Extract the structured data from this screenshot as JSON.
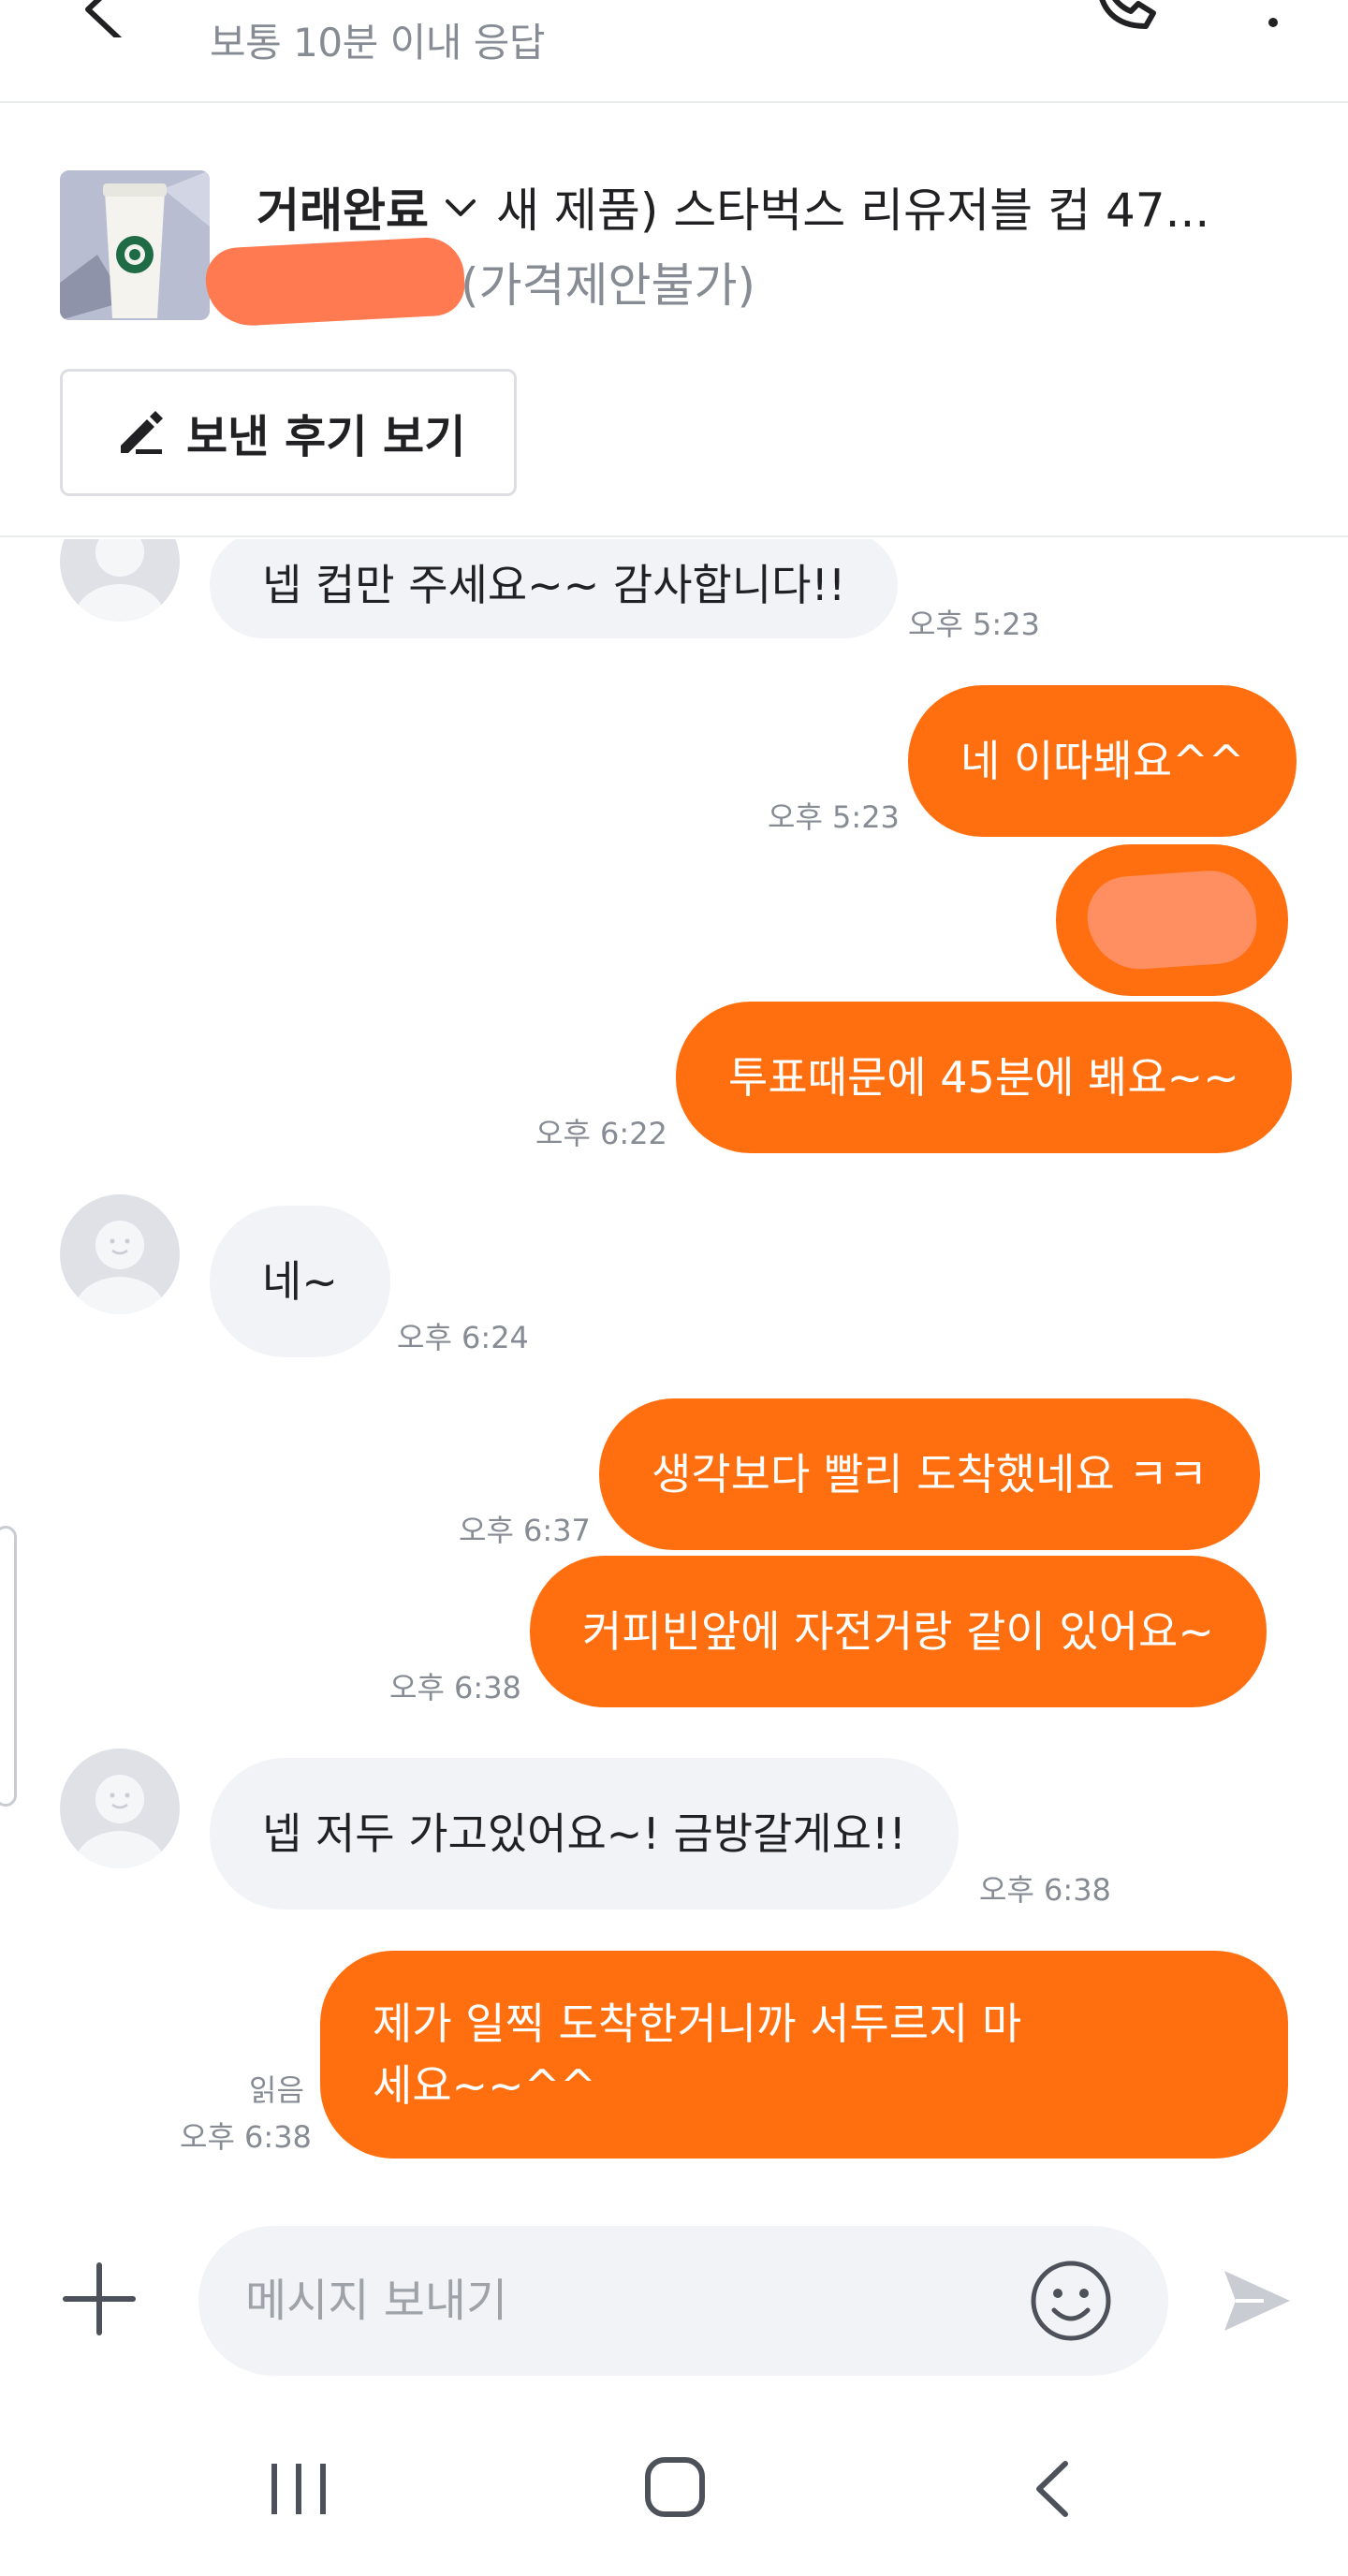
{
  "header": {
    "response_time": "보통 10분 이내 응답"
  },
  "product": {
    "status": "거래완료",
    "title": "새 제품) 스타벅스 리유저블 컵 47...",
    "price_note": "(가격제안불가)",
    "review_button": "보낸 후기 보기"
  },
  "messages": [
    {
      "dir": "in",
      "text": "넵 컵만 주세요~~ 감사합니다!!",
      "time": "오후 5:23"
    },
    {
      "dir": "out",
      "text": "네 이따봬요^^",
      "time": "오후 5:23"
    },
    {
      "dir": "out",
      "text": "",
      "redacted": true
    },
    {
      "dir": "out",
      "text": "투표때문에 45분에 봬요~~",
      "time": "오후 6:22"
    },
    {
      "dir": "in",
      "text": "네~",
      "time": "오후 6:24"
    },
    {
      "dir": "out",
      "text": "생각보다 빨리 도착했네요 ㅋㅋ",
      "time": "오후 6:37"
    },
    {
      "dir": "out",
      "text": "커피빈앞에 자전거랑 같이 있어요~",
      "time": "오후 6:38"
    },
    {
      "dir": "in",
      "text": "넵 저두 가고있어요~! 금방갈게요!!",
      "time": "오후 6:38"
    },
    {
      "dir": "out",
      "text": "제가 일찍 도착한거니까 서두르지 마세요~~^^",
      "time": "오후 6:38",
      "read": "읽음"
    }
  ],
  "input": {
    "placeholder": "메시지 보내기"
  },
  "icons": {
    "back": "back-arrow-icon",
    "call": "phone-icon",
    "more": "more-vertical-icon",
    "dropdown": "chevron-down-icon",
    "review": "pencil-icon",
    "plus": "plus-icon",
    "emoji": "emoji-icon",
    "send": "send-icon"
  },
  "colors": {
    "accent": "#ff6f0f",
    "incoming_bubble": "#f2f3f6",
    "muted_text": "#868b94"
  }
}
